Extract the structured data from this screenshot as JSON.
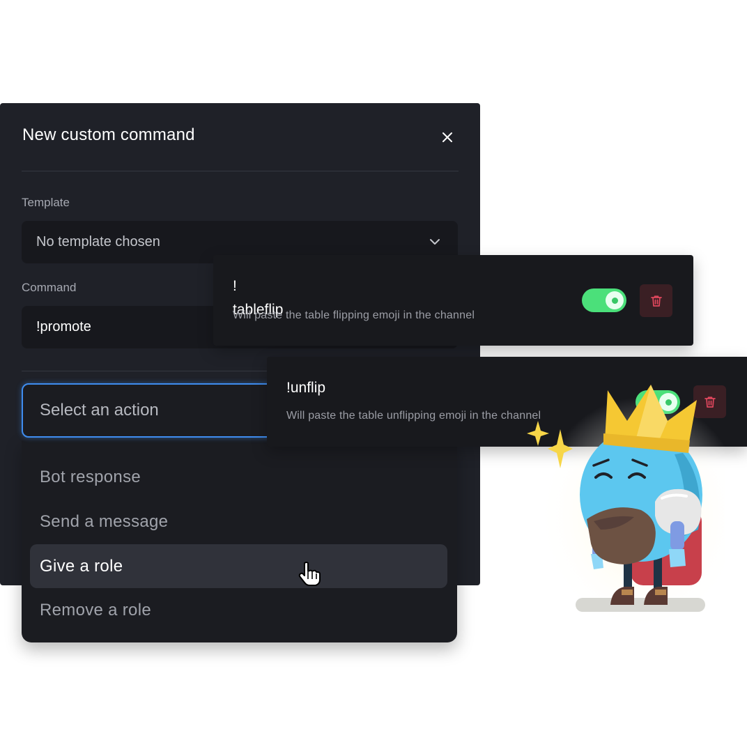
{
  "modal": {
    "title": "New custom command",
    "template_label": "Template",
    "template_value": "No template chosen",
    "command_label": "Command",
    "command_value": "!promote",
    "action_placeholder": "Select an action",
    "action_options": [
      "Bot response",
      "Send a message",
      "Give a role",
      "Remove a role"
    ],
    "selected_option": "Give a role"
  },
  "commands": [
    {
      "name_line1": "!",
      "name_line2": "tableflip",
      "description": "Will paste the table flipping emoji in the channel",
      "enabled": true
    },
    {
      "name": "!unflip",
      "description": "Will paste the table unflipping emoji in the channel",
      "enabled": true
    }
  ],
  "colors": {
    "modal_bg": "#1f2128",
    "accent_focus": "#3f8df0",
    "toggle_on": "#4be07a",
    "delete_bg": "#3a1f24",
    "delete_icon": "#e0475d"
  },
  "icons": [
    "close-icon",
    "chevron-down-icon",
    "trash-icon",
    "hand-cursor-icon"
  ]
}
